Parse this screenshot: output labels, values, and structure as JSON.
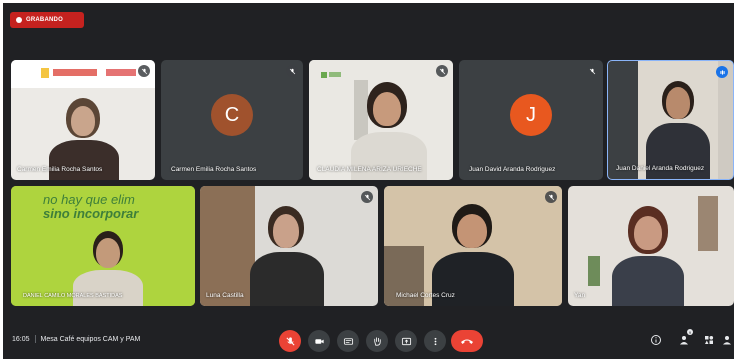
{
  "recording": {
    "label": "GRABANDO"
  },
  "participants": [
    {
      "name": "Carmen Emilia Rocha Santos",
      "type": "video"
    },
    {
      "name": "Carmen Emilia Rocha Santos",
      "type": "avatar",
      "initial": "C",
      "avatar_color": "#a0522d"
    },
    {
      "name": "CLAUDIA MILENA ARIZA URIECHE",
      "type": "video"
    },
    {
      "name": "Juan David Aranda Rodriguez",
      "type": "avatar",
      "initial": "J",
      "avatar_color": "#e8581f"
    },
    {
      "name": "Juan Daniel Aranda Rodriguez",
      "type": "video",
      "active_speaker": true
    },
    {
      "name": "DANIEL CAMILO MORALES BASTIDAS",
      "type": "video",
      "slide_text_1": "no hay que elim",
      "slide_text_2": "sino incorporar"
    },
    {
      "name": "Luna Castilla",
      "type": "video"
    },
    {
      "name": "Michael Cortes Cruz",
      "type": "video"
    },
    {
      "name": "Yan",
      "type": "video"
    }
  ],
  "meeting": {
    "time": "16:05",
    "title": "Mesa Café equipos CAM y PAM"
  },
  "controls": {
    "mic_muted": "mic-off-icon",
    "camera": "camera-icon",
    "captions": "captions-icon",
    "raise_hand": "hand-icon",
    "present": "present-icon",
    "more": "more-icon",
    "leave": "hang-up-icon"
  },
  "right_controls": {
    "info": "info-icon",
    "people": "people-icon",
    "people_count": "9",
    "activities": "activities-icon",
    "host": "host-icon"
  },
  "colors": {
    "background": "#202124",
    "tile": "#3c4043",
    "accent_red": "#ea4335",
    "speaker_border": "#8ab4f8"
  }
}
